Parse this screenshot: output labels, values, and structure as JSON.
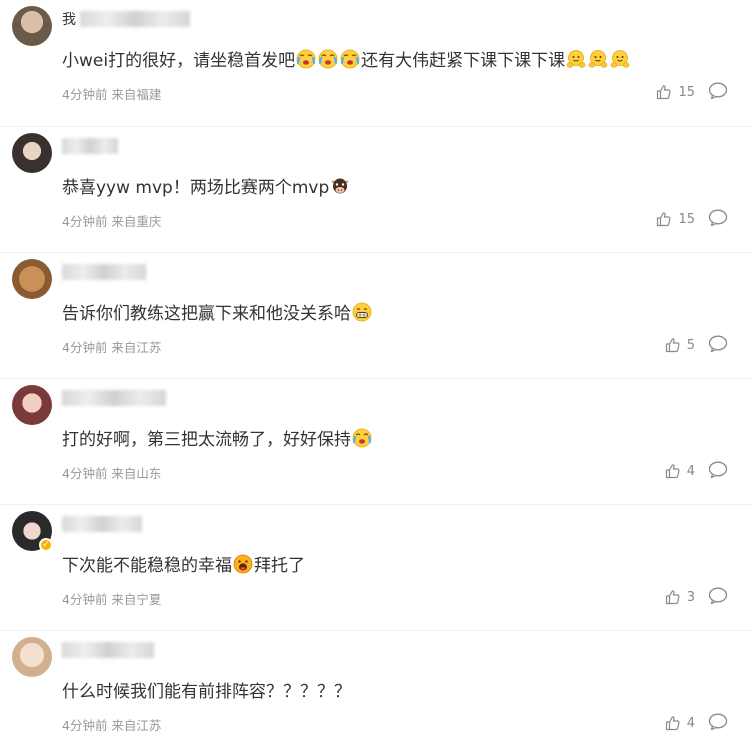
{
  "comments": [
    {
      "username_visible": "我",
      "text": "小wei打的很好，请坐稳首发吧",
      "text_after_emoji": "还有大伟赶紧下课下课下课",
      "emoji_groups": [
        "crying",
        "hug"
      ],
      "meta": "4分钟前 来自福建",
      "likes": "15",
      "avatar_color": "#6b5a4a"
    },
    {
      "username_visible": "",
      "text": "恭喜yyw mvp！两场比赛两个mvp",
      "emoji": "cow",
      "meta": "4分钟前 来自重庆",
      "likes": "15",
      "avatar_color": "#3a3030"
    },
    {
      "username_visible": "",
      "text": "告诉你们教练这把赢下来和他没关系哈",
      "emoji": "grin",
      "meta": "4分钟前 来自江苏",
      "likes": "5",
      "avatar_color": "#b07a4a"
    },
    {
      "username_visible": "",
      "text": "打的好啊，第三把太流畅了，好好保持",
      "emoji": "crying",
      "meta": "4分钟前 来自山东",
      "likes": "4",
      "avatar_color": "#7a3a3a"
    },
    {
      "username_visible": "",
      "text": "下次能不能稳稳的幸福",
      "text_after_emoji": "拜托了",
      "emoji": "shocked",
      "meta": "4分钟前 来自宁夏",
      "likes": "3",
      "avatar_color": "#2a2a2a",
      "verified": true
    },
    {
      "username_visible": "",
      "text": "什么时候我们能有前排阵容？？？？？",
      "meta": "4分钟前 来自江苏",
      "likes": "4",
      "avatar_color": "#e0c8b0"
    }
  ],
  "icons": {
    "like": "thumbs-up-icon",
    "reply": "comment-bubble-icon",
    "verified": "verified-badge-icon"
  }
}
